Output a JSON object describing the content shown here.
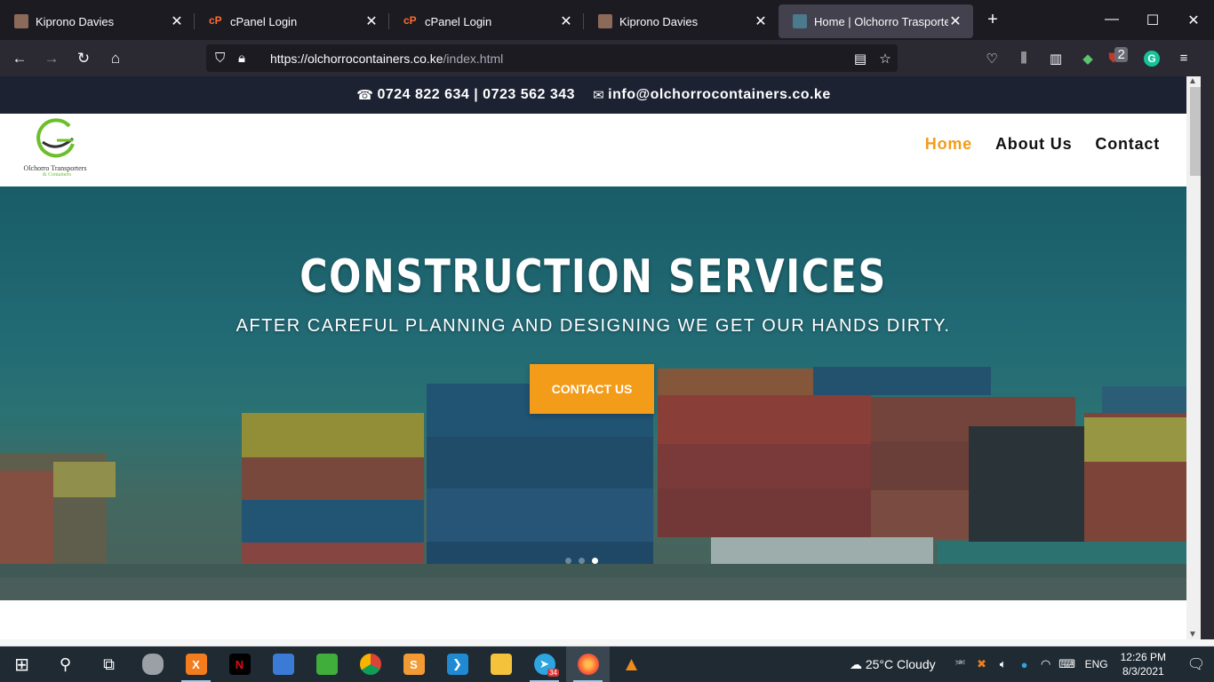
{
  "browser": {
    "tabs": [
      {
        "title": "Kiprono Davies",
        "favicon": "avatar-icon",
        "active": false
      },
      {
        "title": "cPanel Login",
        "favicon": "cpanel-icon",
        "active": false
      },
      {
        "title": "cPanel Login",
        "favicon": "cpanel-icon",
        "active": false
      },
      {
        "title": "Kiprono Davies",
        "favicon": "avatar-icon",
        "active": false
      },
      {
        "title": "Home | Olchorro Trasporters",
        "favicon": "site-icon",
        "active": true
      }
    ],
    "url_host": "https://olchorrocontainers.co.ke",
    "url_path": "/index.html",
    "extension_badge": "2"
  },
  "site": {
    "phone": "0724 822 634 | 0723 562 343",
    "email": "info@olchorrocontainers.co.ke",
    "logo_text": "Olchorro Transporters",
    "logo_subtext": "& Containers",
    "menu": [
      {
        "label": "Home",
        "active": true
      },
      {
        "label": "About Us",
        "active": false
      },
      {
        "label": "Contact",
        "active": false
      }
    ],
    "hero": {
      "title": "CONSTRUCTION SERVICES",
      "subtitle": "AFTER CAREFUL PLANNING AND DESIGNING WE GET OUR HANDS DIRTY.",
      "button": "CONTACT US",
      "slide_count": 3,
      "active_slide": 2
    },
    "accent_color": "#f39c19",
    "topbar_color": "#1d2233"
  },
  "taskbar": {
    "weather": "25°C  Cloudy",
    "language": "ENG",
    "time": "12:26 PM",
    "date": "8/3/2021",
    "telegram_badge": "34"
  }
}
